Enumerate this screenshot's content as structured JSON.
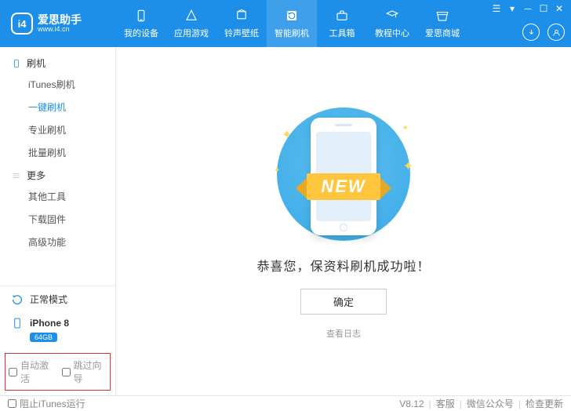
{
  "logo": {
    "badge": "i4",
    "title": "爱思助手",
    "sub": "www.i4.cn"
  },
  "nav": [
    {
      "id": "device",
      "label": "我的设备"
    },
    {
      "id": "apps",
      "label": "应用游戏"
    },
    {
      "id": "ringtone",
      "label": "铃声壁纸"
    },
    {
      "id": "flash",
      "label": "智能刷机",
      "active": true
    },
    {
      "id": "toolbox",
      "label": "工具箱"
    },
    {
      "id": "tutorial",
      "label": "教程中心"
    },
    {
      "id": "mall",
      "label": "爱思商城"
    }
  ],
  "sidebar": {
    "groups": [
      {
        "id": "flash",
        "label": "刷机",
        "items": [
          {
            "label": "iTunes刷机"
          },
          {
            "label": "一键刷机",
            "active": true
          },
          {
            "label": "专业刷机"
          },
          {
            "label": "批量刷机"
          }
        ]
      },
      {
        "id": "more",
        "label": "更多",
        "items": [
          {
            "label": "其他工具"
          },
          {
            "label": "下载固件"
          },
          {
            "label": "高级功能"
          }
        ]
      }
    ],
    "mode": {
      "label": "正常模式"
    },
    "device": {
      "name": "iPhone 8",
      "storage": "64GB"
    },
    "options": {
      "auto_activate": "自动激活",
      "skip_wizard": "跳过向导"
    }
  },
  "main": {
    "ribbon": "NEW",
    "success": "恭喜您，保资料刷机成功啦！",
    "ok": "确定",
    "view_log": "查看日志"
  },
  "footer": {
    "block_itunes": "阻止iTunes运行",
    "version": "V8.12",
    "support": "客服",
    "wechat": "微信公众号",
    "check_update": "检查更新"
  }
}
